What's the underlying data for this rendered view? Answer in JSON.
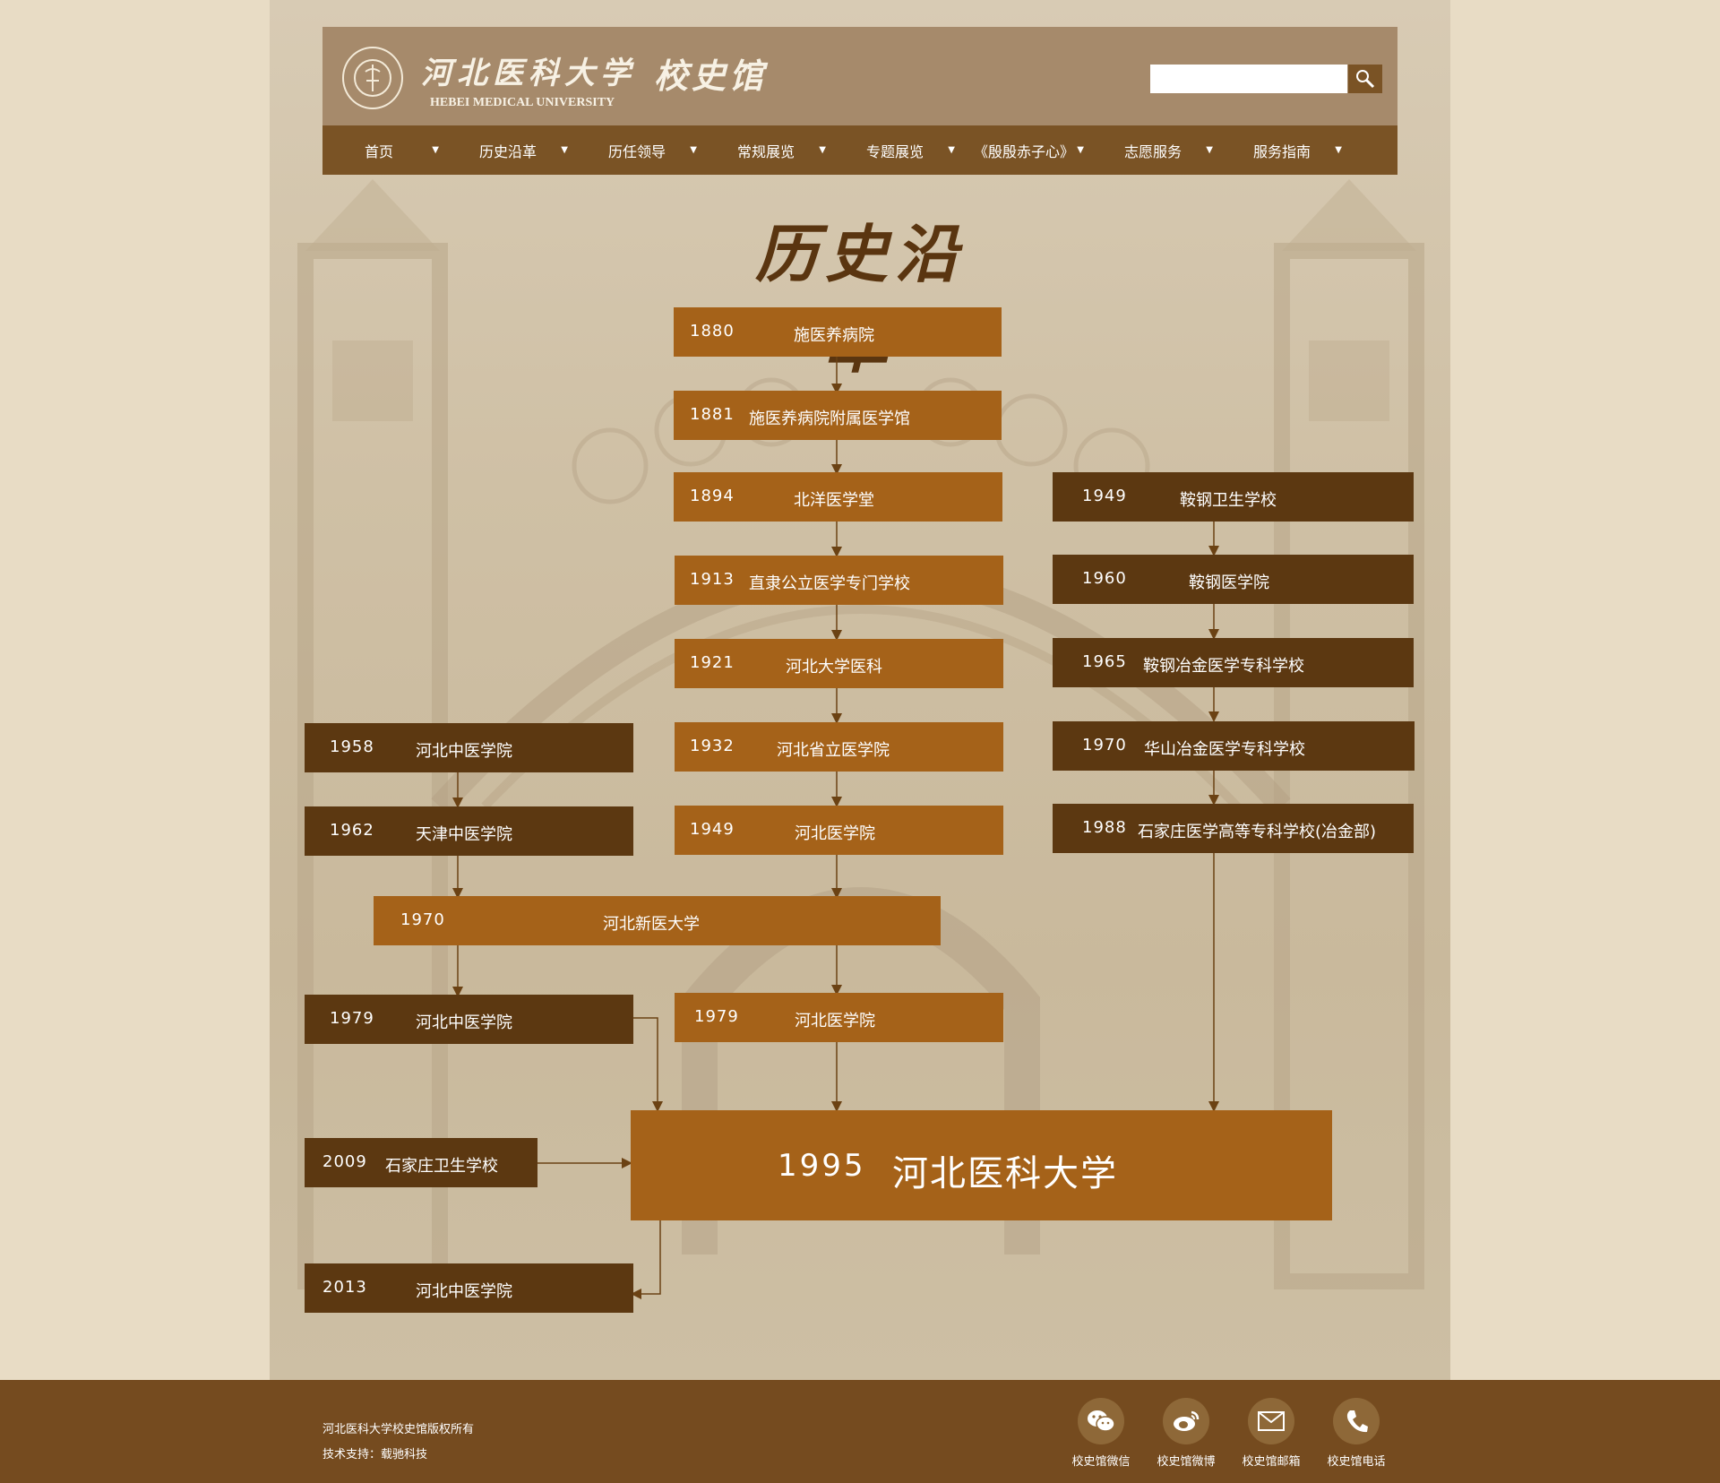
{
  "header": {
    "logo_cn": "河北医科大学",
    "logo_en": "HEBEI MEDICAL UNIVERSITY",
    "logo_sub": "校史馆",
    "search_value": ""
  },
  "nav": {
    "items": [
      "首页",
      "历史沿革",
      "历任领导",
      "常规展览",
      "专题展览",
      "《殷殷赤子心》",
      "志愿服务",
      "服务指南"
    ]
  },
  "section_title": "历史沿革",
  "timeline": {
    "main": [
      {
        "year": "1880",
        "name": "施医养病院"
      },
      {
        "year": "1881",
        "name": "施医养病院附属医学馆"
      },
      {
        "year": "1894",
        "name": "北洋医学堂"
      },
      {
        "year": "1913",
        "name": "直隶公立医学专门学校"
      },
      {
        "year": "1921",
        "name": "河北大学医科"
      },
      {
        "year": "1932",
        "name": "河北省立医学院"
      },
      {
        "year": "1949",
        "name": "河北医学院"
      },
      {
        "year": "1979",
        "name": "河北医学院"
      }
    ],
    "right": [
      {
        "year": "1949",
        "name": "鞍钢卫生学校"
      },
      {
        "year": "1960",
        "name": "鞍钢医学院"
      },
      {
        "year": "1965",
        "name": "鞍钢冶金医学专科学校"
      },
      {
        "year": "1970",
        "name": "华山冶金医学专科学校"
      },
      {
        "year": "1988",
        "name": "石家庄医学高等专科学校(冶金部)"
      }
    ],
    "left": [
      {
        "year": "1958",
        "name": "河北中医学院"
      },
      {
        "year": "1962",
        "name": "天津中医学院"
      },
      {
        "year": "1979",
        "name": "河北中医学院"
      },
      {
        "year": "2009",
        "name": "石家庄卫生学校"
      },
      {
        "year": "2013",
        "name": "河北中医学院"
      }
    ],
    "merged": {
      "year": "1970",
      "name": "河北新医大学"
    },
    "final": {
      "year": "1995",
      "name": "河北医科大学"
    }
  },
  "footer": {
    "copyright": "河北医科大学校史馆版权所有",
    "support": "技术支持：载驰科技",
    "social": [
      {
        "label": "校史馆微信",
        "icon": "wechat-icon"
      },
      {
        "label": "校史馆微博",
        "icon": "weibo-icon"
      },
      {
        "label": "校史馆邮箱",
        "icon": "mail-icon"
      },
      {
        "label": "校史馆电话",
        "icon": "phone-icon"
      }
    ]
  },
  "colors": {
    "page": "#e8dcc5",
    "header": "#a68a6b",
    "nav": "#7a5325",
    "box_light": "#a56219",
    "box_dark": "#5c3811",
    "footer": "#754b1f"
  }
}
